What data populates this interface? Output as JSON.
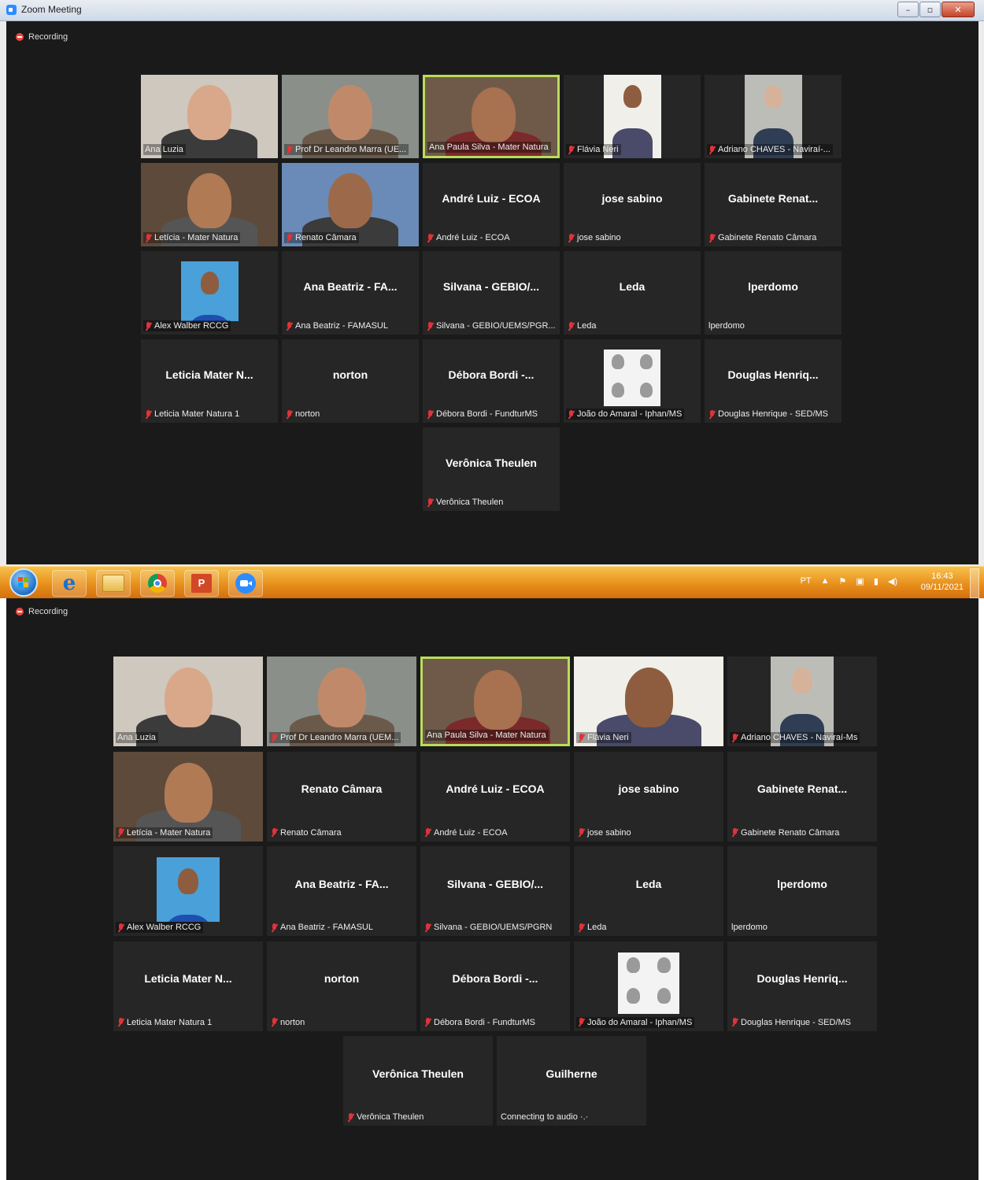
{
  "window": {
    "title": "Zoom Meeting",
    "buttons": [
      "–",
      "▫",
      "✕"
    ]
  },
  "recording_label": "Recording",
  "shot1": {
    "tiles": [
      {
        "big": "",
        "label": "Ana Luzia",
        "muted": false,
        "video": true
      },
      {
        "big": "",
        "label": "Prof Dr Leandro Marra (UE...",
        "muted": true,
        "video": true
      },
      {
        "big": "",
        "label": "Ana Paula Silva - Mater Natura",
        "muted": false,
        "video": true,
        "active": true
      },
      {
        "big": "",
        "label": "Flávia Neri",
        "muted": true,
        "video": true
      },
      {
        "big": "",
        "label": "Adriano CHAVES - Naviraí-...",
        "muted": true,
        "video": true
      },
      {
        "big": "",
        "label": "Letícia - Mater Natura",
        "muted": true,
        "video": true
      },
      {
        "big": "",
        "label": "Renato Câmara",
        "muted": true,
        "video": true
      },
      {
        "big": "André Luiz - ECOA",
        "label": "André Luiz - ECOA",
        "muted": true
      },
      {
        "big": "jose sabino",
        "label": "jose sabino",
        "muted": true
      },
      {
        "big": "Gabinete Renat...",
        "label": "Gabinete Renato Câmara",
        "muted": true
      },
      {
        "big": "",
        "label": "Alex Walber RCCG",
        "muted": true,
        "video": true
      },
      {
        "big": "Ana Beatriz - FA...",
        "label": "Ana Beatriz - FAMASUL",
        "muted": true
      },
      {
        "big": "Silvana - GEBIO/...",
        "label": "Silvana - GEBIO/UEMS/PGR...",
        "muted": true
      },
      {
        "big": "Leda",
        "label": "Leda",
        "muted": true
      },
      {
        "big": "lperdomo",
        "label": "lperdomo",
        "muted": false
      },
      {
        "big": "Leticia Mater N...",
        "label": "Leticia Mater Natura 1",
        "muted": true
      },
      {
        "big": "norton",
        "label": "norton",
        "muted": true
      },
      {
        "big": "Débora Bordi -...",
        "label": "Débora Bordi - FundturMS",
        "muted": true
      },
      {
        "big": "",
        "label": "João do Amaral - Iphan/MS",
        "muted": true,
        "video": true
      },
      {
        "big": "Douglas Henriq...",
        "label": "Douglas Henrique - SED/MS",
        "muted": true
      },
      {
        "big": "Verônica Theulen",
        "label": "Verônica Theulen",
        "muted": true
      }
    ]
  },
  "taskbar": {
    "tray_lang": "PT",
    "tray_icons": [
      "▲",
      "⚑",
      "▣",
      "▮",
      "◀)"
    ],
    "time": "16:43",
    "date": "09/11/2021"
  },
  "shot2": {
    "tiles": [
      {
        "big": "",
        "label": "Ana Luzia",
        "muted": false,
        "video": true
      },
      {
        "big": "",
        "label": "Prof Dr Leandro Marra (UEM...",
        "muted": true,
        "video": true
      },
      {
        "big": "",
        "label": "Ana Paula Silva - Mater Natura",
        "muted": false,
        "video": true,
        "active": true
      },
      {
        "big": "",
        "label": "Flávia Neri",
        "muted": true,
        "video": true
      },
      {
        "big": "",
        "label": "Adriano CHAVES - Naviraí-Ms",
        "muted": true,
        "video": true
      },
      {
        "big": "",
        "label": "Letícia - Mater Natura",
        "muted": true,
        "video": true
      },
      {
        "big": "Renato Câmara",
        "label": "Renato Câmara",
        "muted": true
      },
      {
        "big": "André Luiz - ECOA",
        "label": "André Luiz - ECOA",
        "muted": true
      },
      {
        "big": "jose sabino",
        "label": "jose sabino",
        "muted": true
      },
      {
        "big": "Gabinete Renat...",
        "label": "Gabinete Renato Câmara",
        "muted": true
      },
      {
        "big": "",
        "label": "Alex Walber RCCG",
        "muted": true,
        "video": true
      },
      {
        "big": "Ana Beatriz - FA...",
        "label": "Ana Beatriz - FAMASUL",
        "muted": true
      },
      {
        "big": "Silvana - GEBIO/...",
        "label": "Silvana - GEBIO/UEMS/PGRN",
        "muted": true
      },
      {
        "big": "Leda",
        "label": "Leda",
        "muted": true
      },
      {
        "big": "lperdomo",
        "label": "lperdomo",
        "muted": false
      },
      {
        "big": "Leticia Mater N...",
        "label": "Leticia Mater Natura 1",
        "muted": true
      },
      {
        "big": "norton",
        "label": "norton",
        "muted": true
      },
      {
        "big": "Débora Bordi -...",
        "label": "Débora Bordi - FundturMS",
        "muted": true
      },
      {
        "big": "",
        "label": "João do Amaral - Iphan/MS",
        "muted": true,
        "video": true
      },
      {
        "big": "Douglas Henriq...",
        "label": "Douglas Henrique - SED/MS",
        "muted": true
      },
      {
        "big": "Verônica Theulen",
        "label": "Verônica Theulen",
        "muted": true
      },
      {
        "big": "Guilherne",
        "label": "Connecting to audio ·.·",
        "muted": false
      }
    ]
  }
}
